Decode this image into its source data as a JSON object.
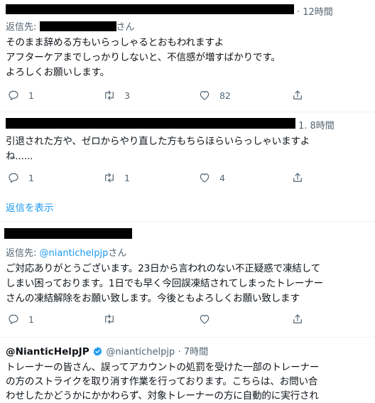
{
  "tweets": [
    {
      "time": "· 12時間",
      "reply_to_prefix": "返信先: ",
      "reply_to_suffix": "さん",
      "body": [
        "そのまま辞める方もいらっしゃるとおもわれますよ",
        "アフターケアまでしっかりしないと、不信感が増すばかりです。",
        "よろしくお願いします。"
      ],
      "replies": "1",
      "retweets": "3",
      "likes": "82"
    },
    {
      "time": "1. 8時間",
      "body": [
        "引退された方や、ゼロからやり直した方もちらほらいらっしゃいますよ",
        "ね......"
      ],
      "replies": "1",
      "retweets": "1",
      "likes": "4"
    },
    {
      "reply_to_prefix": "返信先: ",
      "reply_to_handle": "@niantichelpjp",
      "reply_to_suffix": "さん",
      "body": [
        "ご対応ありがとうございます。23日から言われのない不正疑惑で凍結して",
        "しまい困っております。1日でも早く今回誤凍結されてしまったトレーナー",
        "さんの凍結解除をお願い致します。今後ともよろしくお願い致します"
      ],
      "replies": "1"
    },
    {
      "display_name": "@NianticHelpJP",
      "handle": "@niantichelpjp",
      "time": "· 7時間",
      "body": [
        "トレーナーの皆さん、誤ってアカウントの処罰を受けた一部のトレーナー",
        "の方のストライクを取り消す作業を行っております。こちらは、お問い合",
        "わせしたかどうかにかかわらず、対象トレーナーの方に自動的に実行され"
      ]
    }
  ],
  "show_replies": "返信を表示",
  "colors": {
    "accent": "#1d9bf0",
    "muted": "#536471",
    "text": "#0f1419",
    "divider": "#eff3f4",
    "verified": "#1d9bf0"
  }
}
